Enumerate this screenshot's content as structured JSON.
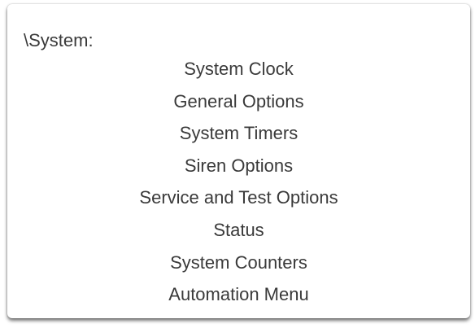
{
  "panel": {
    "path_label": "\\System:",
    "menu_items": [
      {
        "label": "System Clock"
      },
      {
        "label": "General Options"
      },
      {
        "label": "System Timers"
      },
      {
        "label": "Siren Options"
      },
      {
        "label": "Service and Test Options"
      },
      {
        "label": "Status"
      },
      {
        "label": "System Counters"
      },
      {
        "label": "Automation Menu"
      }
    ]
  }
}
